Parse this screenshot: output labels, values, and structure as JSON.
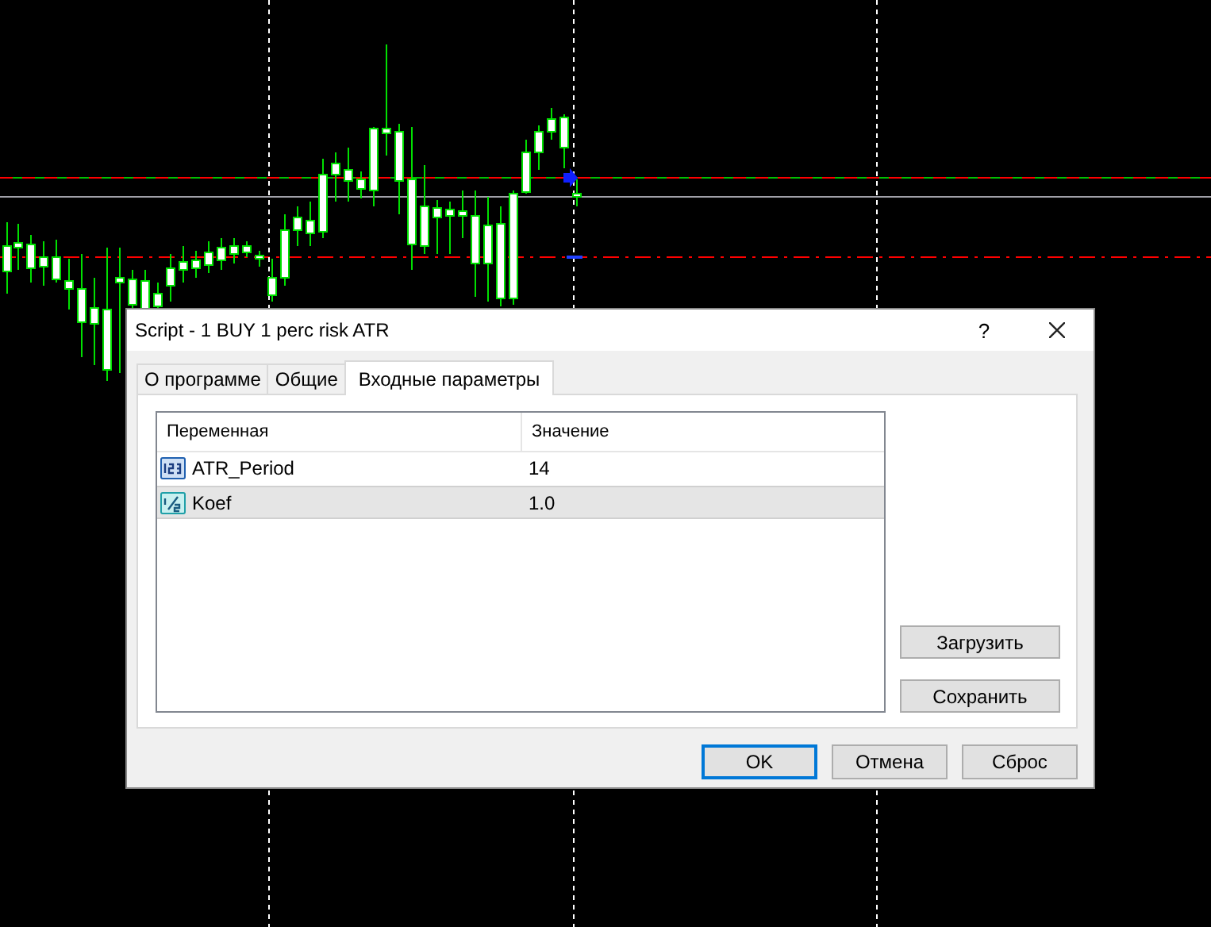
{
  "window": {
    "title": "Script - 1 BUY 1 perc risk ATR",
    "help_label": "?"
  },
  "tabs": [
    {
      "label": "О программе",
      "selected": false
    },
    {
      "label": "Общие",
      "selected": false
    },
    {
      "label": "Входные параметры",
      "selected": true
    }
  ],
  "table": {
    "columns": [
      "Переменная",
      "Значение"
    ],
    "rows": [
      {
        "name": "ATR_Period",
        "value": "14",
        "kind": "int",
        "selected": false
      },
      {
        "name": "Koef",
        "value": "1.0",
        "kind": "double",
        "selected": true
      }
    ]
  },
  "side_buttons": [
    "Загрузить",
    "Сохранить"
  ],
  "buttons": [
    {
      "label": "OK",
      "default": true
    },
    {
      "label": "Отмена",
      "default": false
    },
    {
      "label": "Сброс",
      "default": false
    }
  ]
}
